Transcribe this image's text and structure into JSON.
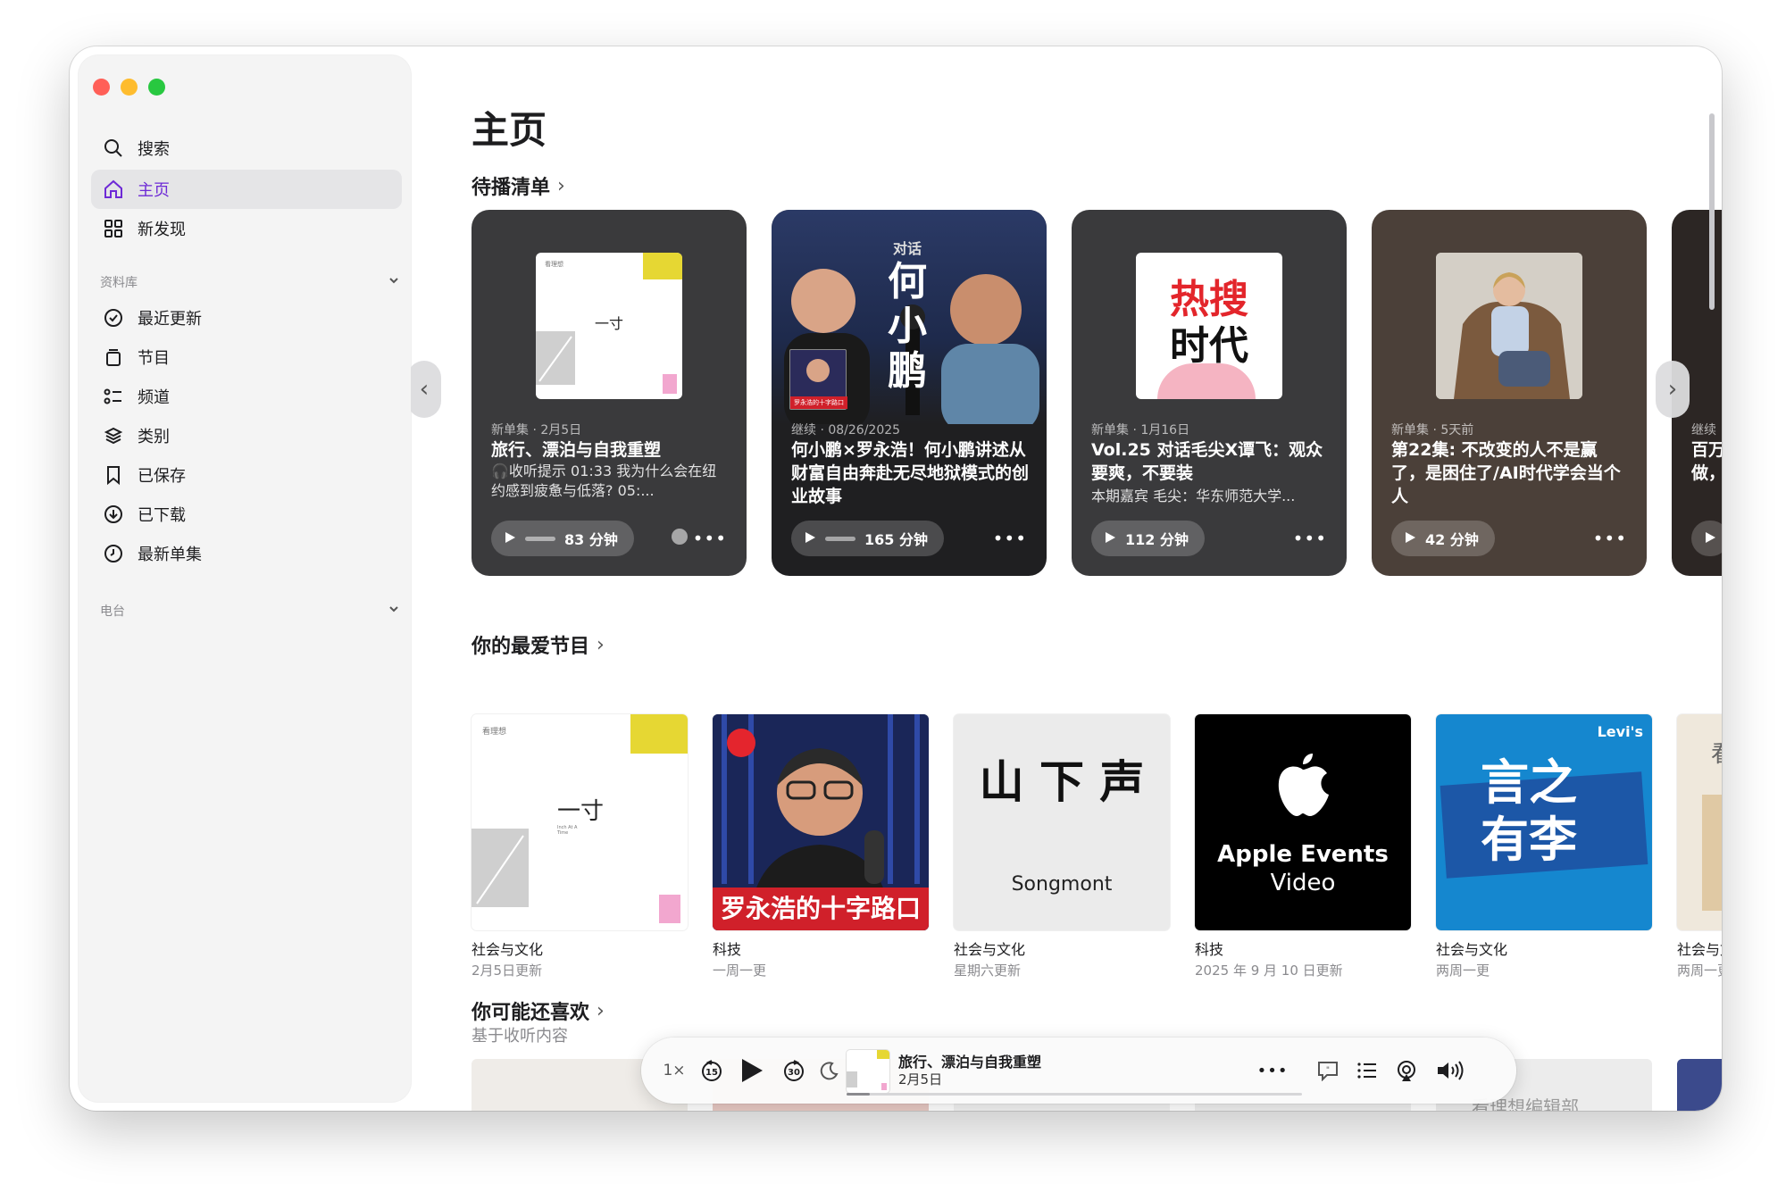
{
  "sidebar": {
    "top_items": [
      {
        "label": "搜索",
        "icon": "search-icon"
      },
      {
        "label": "主页",
        "icon": "home-icon",
        "active": true
      },
      {
        "label": "新发现",
        "icon": "grid-icon"
      }
    ],
    "library_label": "资料库",
    "library_items": [
      {
        "label": "最近更新",
        "icon": "checkmark-circle-icon"
      },
      {
        "label": "节目",
        "icon": "stack-icon"
      },
      {
        "label": "频道",
        "icon": "channels-icon"
      },
      {
        "label": "类别",
        "icon": "categories-icon"
      },
      {
        "label": "已保存",
        "icon": "bookmark-icon"
      },
      {
        "label": "已下载",
        "icon": "download-circle-icon"
      },
      {
        "label": "最新单集",
        "icon": "clock-icon"
      }
    ],
    "radio_label": "电台"
  },
  "main": {
    "title": "主页",
    "up_next": {
      "title": "待播清单",
      "cards": [
        {
          "meta": "新单集 · 2月5日",
          "title": "旅行、漂泊与自我重塑",
          "desc": "🎧收听提示 01:33 我为什么会在纽约感到疲惫与低落? 05:...",
          "duration": "83 分钟",
          "bg": "#3a3a3c"
        },
        {
          "meta": "继续 · 08/26/2025",
          "title": "何小鹏×罗永浩！何小鹏讲述从财富自由奔赴无尽地狱模式的创业故事",
          "desc": "",
          "duration": "165 分钟",
          "bg": "#1f1f21"
        },
        {
          "meta": "新单集 · 1月16日",
          "title": "Vol.25 对话毛尖X谭飞：观众要爽，不要装",
          "desc": "本期嘉宾 毛尖：华东师范大学...",
          "duration": "112 分钟",
          "bg": "#3a3a3c"
        },
        {
          "meta": "新单集 · 5天前",
          "title": "第22集: 不改变的人不是赢了，是困住了/AI时代学会当个人",
          "desc": "",
          "duration": "42 分钟",
          "bg": "#4b4039"
        },
        {
          "meta": "继续",
          "title": "百万做，",
          "desc": "",
          "duration": "",
          "bg": "#2c2624"
        }
      ],
      "art": {
        "card1_brand": "看理想",
        "card1_name": "一寸",
        "card2_top": "对话",
        "card2_name": "何小鹏",
        "card2_inset": "罗永浩的十字路口",
        "card3_name_line1": "热搜",
        "card3_name_line2": "时代"
      }
    },
    "favorites": {
      "title": "你的最爱节目",
      "shows": [
        {
          "category": "社会与文化",
          "updated": "2月5日更新"
        },
        {
          "category": "科技",
          "updated": "一周一更"
        },
        {
          "category": "社会与文化",
          "updated": "星期六更新"
        },
        {
          "category": "科技",
          "updated": "2025 年 9 月 10 日更新"
        },
        {
          "category": "社会与文化",
          "updated": "两周一更"
        },
        {
          "category": "社会与文化",
          "updated": "两周一更"
        }
      ],
      "art": {
        "show1_brand": "看理想",
        "show1_name": "一寸",
        "show1_small": "Inch At A Time",
        "show2_name": "罗永浩的十字路口",
        "show3_name": "山 下 声",
        "show3_sub": "Songmont",
        "show4_line1": "Apple Events",
        "show4_line2": "Video",
        "show5_brand": "Levi's",
        "show5_name_line1": "言之",
        "show5_name_line2": "有李",
        "show6_char": "看"
      }
    },
    "recommend": {
      "title": "你可能还喜欢",
      "subtitle": "基于收听内容",
      "thumb_text": "看理想编辑部"
    }
  },
  "player": {
    "speed": "1×",
    "skip_back": "15",
    "skip_forward": "30",
    "episode_title": "旅行、漂泊与自我重塑",
    "episode_date": "2月5日",
    "progress": 0.05
  },
  "colors": {
    "accent": "#6e2ad6",
    "traffic_red": "#ff5f57",
    "traffic_yellow": "#febc2e",
    "traffic_green": "#28c840"
  }
}
